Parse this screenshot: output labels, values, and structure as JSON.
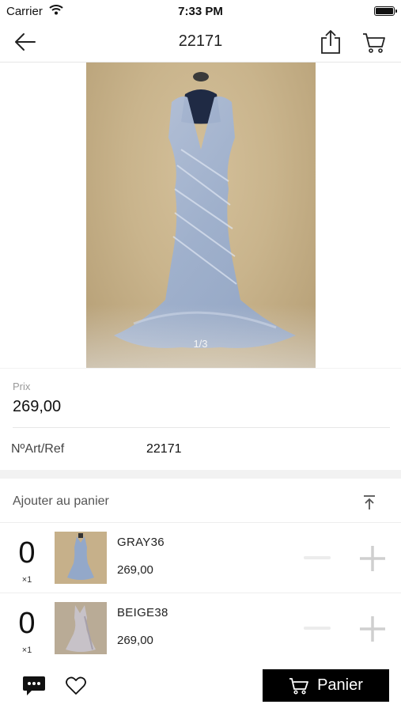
{
  "status_bar": {
    "carrier": "Carrier",
    "time": "7:33 PM"
  },
  "nav": {
    "title": "22171",
    "icons": [
      "back-arrow-icon",
      "share-icon",
      "cart-icon"
    ]
  },
  "gallery": {
    "counter": "1/3"
  },
  "price": {
    "label": "Prix",
    "value": "269,00"
  },
  "reference": {
    "label": "NºArt/Ref",
    "value": "22171"
  },
  "cart_section": {
    "title": "Ajouter au panier",
    "variants": [
      {
        "qty": "0",
        "multiplier": "×1",
        "name": "GRAY36",
        "price": "269,00"
      },
      {
        "qty": "0",
        "multiplier": "×1",
        "name": "BEIGE38",
        "price": "269,00"
      }
    ]
  },
  "bottom_bar": {
    "cart_button_label": "Panier",
    "icons": [
      "chat-icon",
      "heart-icon"
    ]
  },
  "colors": {
    "accent": "#000000",
    "background": "#f2f2f2",
    "dress": "#9fb0cc"
  }
}
